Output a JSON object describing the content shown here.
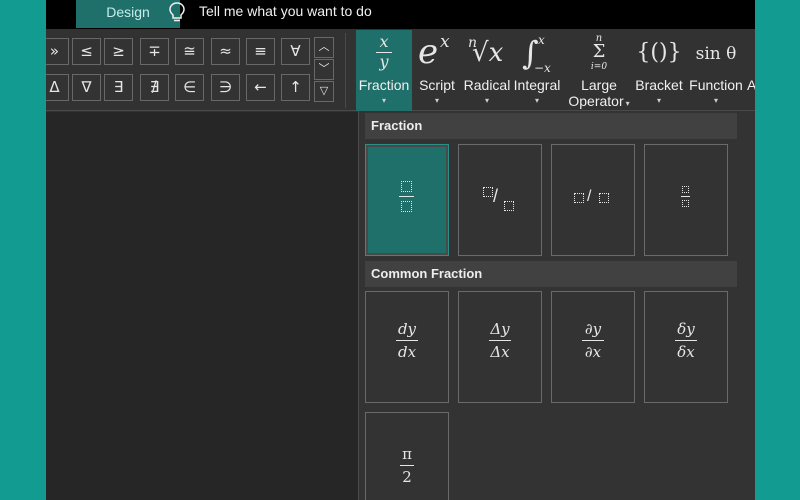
{
  "topbar": {
    "tab_label": "Design",
    "search_placeholder": "Tell me what you want to do",
    "search_icon": "lightbulb-icon"
  },
  "symbols": {
    "row1": [
      "»",
      "≤",
      "≥",
      "∓",
      "≅",
      "≈",
      "≡",
      "∀"
    ],
    "row2": [
      "Δ",
      "∇",
      "∃",
      "∄",
      "∈",
      "∋",
      "←",
      "↑"
    ]
  },
  "gallery_nav": {
    "up": "︿",
    "down": "﹀",
    "more": "▽"
  },
  "ribbon": {
    "fraction": {
      "label": "Fraction",
      "icon_top": "x",
      "icon_bottom": "y"
    },
    "script": {
      "label": "Script",
      "icon_base": "e",
      "icon_sup": "x"
    },
    "radical": {
      "label": "Radical",
      "icon_index": "n",
      "icon_body": "√x"
    },
    "integral": {
      "label": "Integral",
      "icon_body": "∫",
      "icon_sup": "x",
      "icon_sub": "−x"
    },
    "large_operator": {
      "label_line1": "Large",
      "label_line2": "Operator",
      "icon_sup": "n",
      "icon_body": "Σ",
      "icon_sub": "i=0"
    },
    "bracket": {
      "label": "Bracket",
      "icon_body": "{()}"
    },
    "function": {
      "label": "Function",
      "icon_body": "sin θ"
    },
    "accent": {
      "label": "A"
    },
    "caret": "▾"
  },
  "fraction_gallery": {
    "section1": "Fraction",
    "section2": "Common Fraction",
    "common": [
      {
        "num": "dy",
        "den": "dx"
      },
      {
        "num": "Δy",
        "den": "Δx"
      },
      {
        "num": "∂y",
        "den": "∂x"
      },
      {
        "num": "δy",
        "den": "δx"
      },
      {
        "num": "π",
        "den": "2"
      }
    ],
    "slash": "/"
  },
  "colors": {
    "accent": "#1f6f6a",
    "frame": "#129b91"
  }
}
